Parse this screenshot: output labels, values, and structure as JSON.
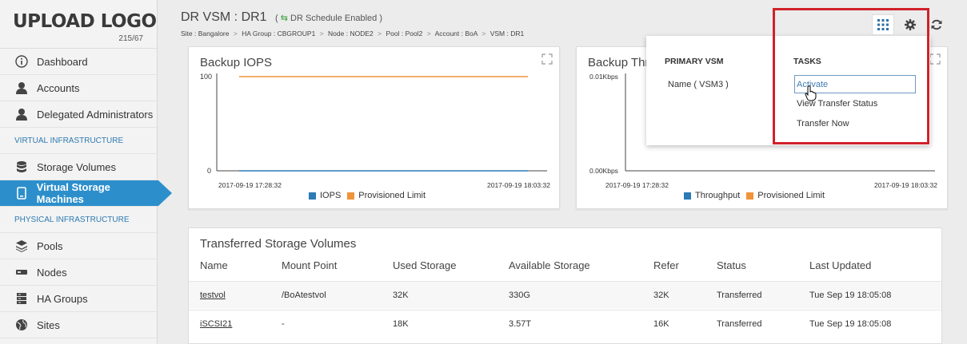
{
  "logo": {
    "text": "UPLOAD LOGO",
    "version": "215/67"
  },
  "sidebar": {
    "items": [
      {
        "label": "Dashboard",
        "icon": "info-icon"
      },
      {
        "label": "Accounts",
        "icon": "user-icon"
      },
      {
        "label": "Delegated Administrators",
        "icon": "user-icon"
      }
    ],
    "section1": "VIRTUAL INFRASTRUCTURE",
    "items2": [
      {
        "label": "Storage Volumes",
        "icon": "database-icon"
      },
      {
        "label": "Virtual Storage Machines",
        "icon": "monitor-icon"
      }
    ],
    "section2": "PHYSICAL INFRASTRUCTURE",
    "items3": [
      {
        "label": "Pools",
        "icon": "layers-icon"
      },
      {
        "label": "Nodes",
        "icon": "node-icon"
      },
      {
        "label": "HA Groups",
        "icon": "server-icon"
      },
      {
        "label": "Sites",
        "icon": "globe-icon"
      }
    ]
  },
  "header": {
    "title": "DR VSM : DR1",
    "badge": "DR Schedule Enabled",
    "breadcrumb": [
      "Site : Bangalore",
      "HA Group : CBGROUP1",
      "Node : NODE2",
      "Pool : Pool2",
      "Account : BoA",
      "VSM : DR1"
    ],
    "sep": ">"
  },
  "chart_iops": {
    "title": "Backup IOPS",
    "chart_data": {
      "type": "line",
      "x": [
        "2017-09-19 17:28:32",
        "2017-09-19 18:03:32"
      ],
      "ylim": [
        0,
        100
      ],
      "yticks": [
        "100",
        "0"
      ],
      "series": [
        {
          "name": "IOPS",
          "values": [
            0,
            0
          ],
          "color": "#2c7bb6"
        },
        {
          "name": "Provisioned Limit",
          "values": [
            100,
            100
          ],
          "color": "#f0933a"
        }
      ]
    }
  },
  "chart_tp": {
    "title": "Backup Thr",
    "chart_data": {
      "type": "line",
      "x": [
        "2017-09-19 17:28:32",
        "2017-09-19 18:03:32"
      ],
      "yticks": [
        "0.01Kbps",
        "0.00Kbps"
      ],
      "series": [
        {
          "name": "Throughput",
          "color": "#2c7bb6"
        },
        {
          "name": "Provisioned Limit",
          "color": "#f0933a"
        }
      ]
    }
  },
  "popup": {
    "primary_heading": "PRIMARY VSM",
    "primary_name": "Name ( VSM3 )",
    "tasks_heading": "TASKS",
    "tasks": [
      "Activate",
      "View Transfer Status",
      "Transfer Now"
    ]
  },
  "table": {
    "title": "Transferred Storage Volumes",
    "columns": [
      "Name",
      "Mount Point",
      "Used Storage",
      "Available Storage",
      "Refer",
      "Status",
      "Last Updated"
    ],
    "rows": [
      [
        "testvol",
        "/BoAtestvol",
        "32K",
        "330G",
        "32K",
        "Transferred",
        "Tue Sep 19 18:05:08"
      ],
      [
        "iSCSI21",
        "-",
        "18K",
        "3.57T",
        "16K",
        "Transferred",
        "Tue Sep 19 18:05:08"
      ]
    ]
  },
  "colors": {
    "accent": "#2c8fcc",
    "highlight": "#d0222a",
    "series_blue": "#2c7bb6",
    "series_orange": "#f0933a"
  }
}
